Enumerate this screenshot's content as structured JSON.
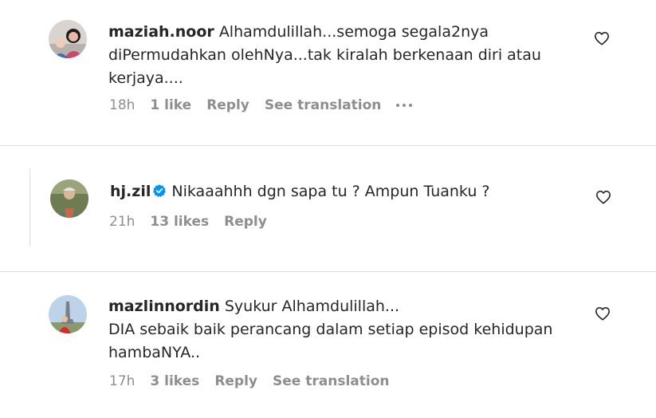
{
  "comments": [
    {
      "username": "maziah.noor",
      "text": "Alhamdulillah...semoga segala2nya\ndiPermudahkan olehNya...tak kiralah berkenaan diri atau\nkerjaya....",
      "time": "18h",
      "likes": "1 like",
      "reply_label": "Reply",
      "translate_label": "See translation"
    },
    {
      "username": "hj.zil",
      "verified": true,
      "text": "Nikaaahhh dgn sapa tu ? Ampun Tuanku ?",
      "time": "21h",
      "likes": "13 likes",
      "reply_label": "Reply"
    },
    {
      "username": "mazlinnordin",
      "text": "Syukur Alhamdulillah...\nDIA sebaik baik perancang dalam setiap episod kehidupan\nhambaNYA..",
      "time": "17h",
      "likes": "3 likes",
      "reply_label": "Reply",
      "translate_label": "See translation"
    }
  ],
  "colors": {
    "text": "#262626",
    "secondary": "#8e8e8e",
    "verified": "#0095f6",
    "divider": "#dbdbdb"
  },
  "icons": {
    "like": "heart-outline-icon",
    "more": "more-options-icon",
    "verified": "verified-badge-icon"
  }
}
